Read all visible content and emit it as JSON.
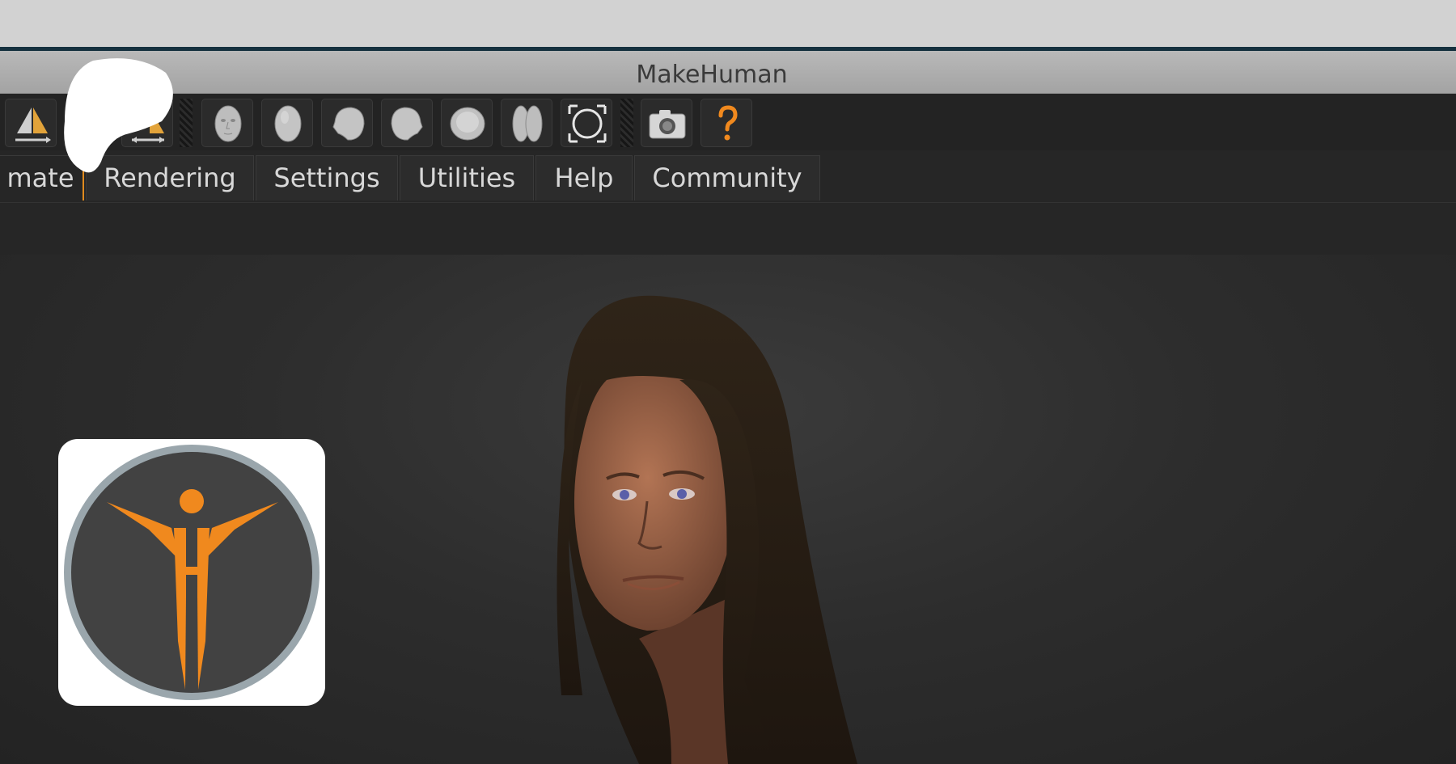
{
  "window": {
    "title": "MakeHuman"
  },
  "toolbar": {
    "buttons": [
      {
        "name": "symmetry-right-icon"
      },
      {
        "name": "symmetry-both-icon"
      },
      {
        "name": "front-view-icon"
      },
      {
        "name": "back-view-icon"
      },
      {
        "name": "left-view-icon"
      },
      {
        "name": "right-view-icon"
      },
      {
        "name": "top-view-icon"
      },
      {
        "name": "wireframe-icon"
      },
      {
        "name": "reset-camera-icon"
      },
      {
        "name": "screenshot-icon"
      },
      {
        "name": "help-icon"
      }
    ]
  },
  "tabs": [
    {
      "label": "mate"
    },
    {
      "label": "Rendering"
    },
    {
      "label": "Settings"
    },
    {
      "label": "Utilities"
    },
    {
      "label": "Help"
    },
    {
      "label": "Community"
    }
  ],
  "logo": {
    "name": "makehuman-logo"
  },
  "colors": {
    "accent": "#f0891e",
    "viewport_bg": "#2d2d2d",
    "titlebar": "#b0b0b0"
  }
}
